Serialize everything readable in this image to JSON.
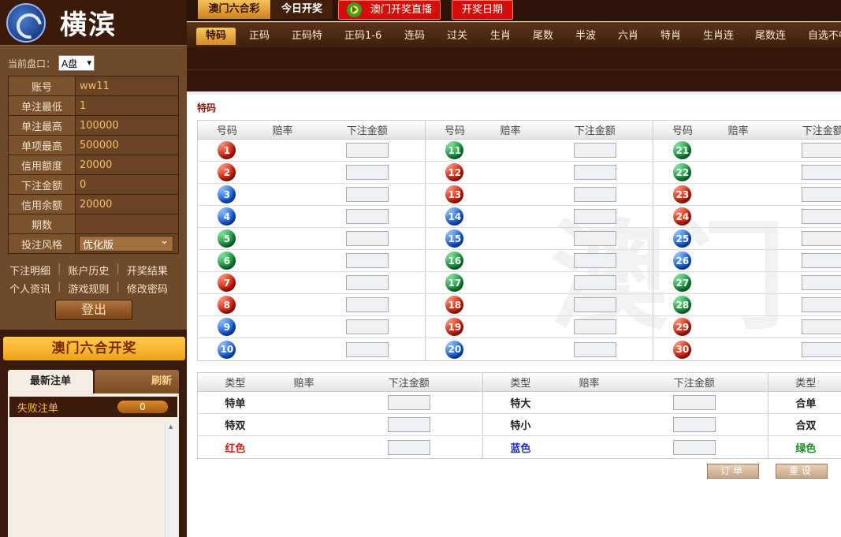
{
  "sidebar": {
    "logo_text": "横滨",
    "pan_label": "当前盘口：",
    "pan_value": "A盘",
    "info": [
      {
        "label": "账号",
        "value": "ww11"
      },
      {
        "label": "单注最低",
        "value": "1"
      },
      {
        "label": "单注最高",
        "value": "100000"
      },
      {
        "label": "单项最高",
        "value": "500000"
      },
      {
        "label": "信用额度",
        "value": "20000"
      },
      {
        "label": "下注金额",
        "value": "0"
      },
      {
        "label": "信用余额",
        "value": "20000"
      },
      {
        "label": "期数",
        "value": ""
      }
    ],
    "style_label": "投注风格",
    "style_value": "优化版",
    "links_row1": [
      "下注明细",
      "账户历史",
      "开奖结果"
    ],
    "links_row2": [
      "个人资讯",
      "游戏规则",
      "修改密码"
    ],
    "logout_label": "登出",
    "banner": "澳门六合开奖",
    "tab_latest": "最新注单",
    "tab_refresh": "刷新",
    "failed_label": "失败注单",
    "failed_count": "0"
  },
  "topbar": {
    "tab_macau": "澳门六合彩",
    "tab_today": "今日开奖",
    "live_label": "澳门开奖直播",
    "date_label": "开奖日期"
  },
  "nav": [
    "特码",
    "正码",
    "正码特",
    "正码1-6",
    "连码",
    "过关",
    "生肖",
    "尾数",
    "半波",
    "六肖",
    "特肖",
    "生肖连",
    "尾数连",
    "自选不中"
  ],
  "main": {
    "section_title": "特码",
    "headers": {
      "num": "号码",
      "odds": "赔率",
      "amount": "下注金额",
      "type": "类型"
    },
    "columns": [
      [
        {
          "n": "1",
          "c": "red"
        },
        {
          "n": "2",
          "c": "red"
        },
        {
          "n": "3",
          "c": "blue"
        },
        {
          "n": "4",
          "c": "blue"
        },
        {
          "n": "5",
          "c": "green"
        },
        {
          "n": "6",
          "c": "green"
        },
        {
          "n": "7",
          "c": "red"
        },
        {
          "n": "8",
          "c": "red"
        },
        {
          "n": "9",
          "c": "blue"
        },
        {
          "n": "10",
          "c": "blue"
        }
      ],
      [
        {
          "n": "11",
          "c": "green"
        },
        {
          "n": "12",
          "c": "red"
        },
        {
          "n": "13",
          "c": "red"
        },
        {
          "n": "14",
          "c": "blue"
        },
        {
          "n": "15",
          "c": "blue"
        },
        {
          "n": "16",
          "c": "green"
        },
        {
          "n": "17",
          "c": "green"
        },
        {
          "n": "18",
          "c": "red"
        },
        {
          "n": "19",
          "c": "red"
        },
        {
          "n": "20",
          "c": "blue"
        }
      ],
      [
        {
          "n": "21",
          "c": "green"
        },
        {
          "n": "22",
          "c": "green"
        },
        {
          "n": "23",
          "c": "red"
        },
        {
          "n": "24",
          "c": "red"
        },
        {
          "n": "25",
          "c": "blue"
        },
        {
          "n": "26",
          "c": "blue"
        },
        {
          "n": "27",
          "c": "green"
        },
        {
          "n": "28",
          "c": "green"
        },
        {
          "n": "29",
          "c": "red"
        },
        {
          "n": "30",
          "c": "red"
        }
      ]
    ],
    "types": [
      [
        "特单",
        "特大",
        "合单"
      ],
      [
        "特双",
        "特小",
        "合双"
      ],
      [
        "红色",
        "蓝色",
        "绿色"
      ]
    ],
    "btn_order": "订单",
    "btn_reset": "重设"
  },
  "colors": {
    "red": "#cc1a08",
    "blue": "#1258d6",
    "green": "#128a3a",
    "accent": "#d40c0c"
  }
}
